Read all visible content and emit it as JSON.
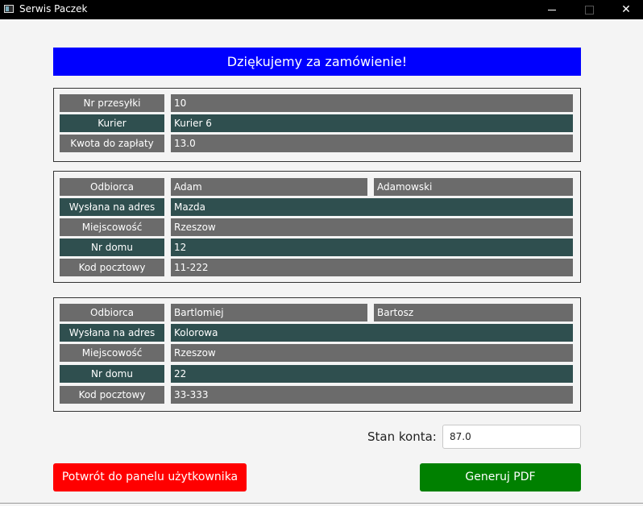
{
  "window": {
    "title": "Serwis Paczek",
    "minimize": "–",
    "maximize": "□",
    "close": "✕"
  },
  "header": {
    "text": "Dziękujemy za zamówienie!"
  },
  "order": {
    "number_label": "Nr przesyłki",
    "number_value": "10",
    "courier_label": "Kurier",
    "courier_value": "Kurier 6",
    "amount_label": "Kwota do zapłaty",
    "amount_value": "13.0"
  },
  "recipients": [
    {
      "recipient_label": "Odbiorca",
      "first_name": "Adam",
      "last_name": "Adamowski",
      "street_label": "Wysłana na adres",
      "street": "Mazda",
      "city_label": "Miejscowość",
      "city": "Rzeszow",
      "house_label": "Nr domu",
      "house": "12",
      "postal_label": "Kod pocztowy",
      "postal": "11-222"
    },
    {
      "recipient_label": "Odbiorca",
      "first_name": "Bartlomiej",
      "last_name": "Bartosz",
      "street_label": "Wysłana na adres",
      "street": "Kolorowa",
      "city_label": "Miejscowość",
      "city": "Rzeszow",
      "house_label": "Nr domu",
      "house": "22",
      "postal_label": "Kod pocztowy",
      "postal": "33-333"
    }
  ],
  "balance": {
    "label": "Stan konta:",
    "value": "87.0"
  },
  "buttons": {
    "back": "Potwrót do panelu użytkownika",
    "pdf": "Generuj PDF"
  },
  "colors": {
    "header_bg": "#0000ff",
    "row_gray": "#6b6b6b",
    "row_teal": "#2f4f4f",
    "back_button": "#ff0000",
    "pdf_button": "#008000"
  }
}
